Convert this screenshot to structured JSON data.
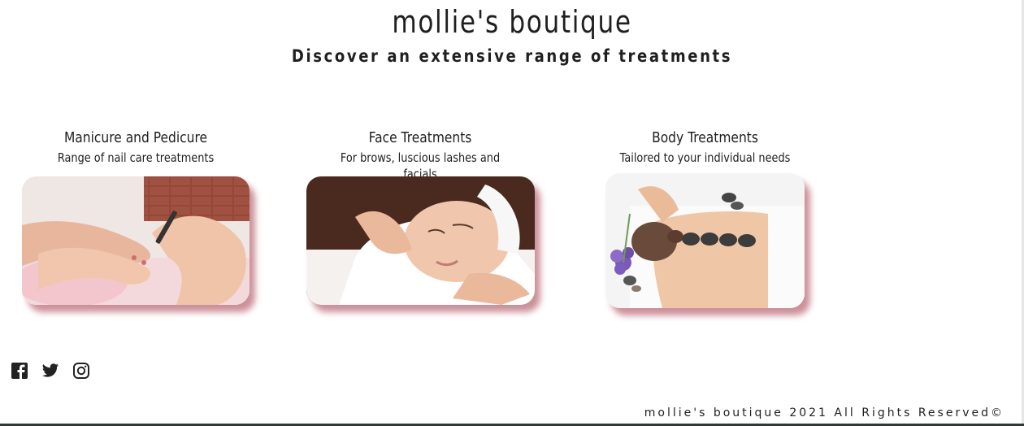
{
  "header": {
    "brand": "mollie's boutique",
    "tagline": "Discover an extensive range of treatments"
  },
  "cards": [
    {
      "title": "Manicure and Pedicure",
      "subtitle": "Range of nail care treatments",
      "image_icon": "manicure-photo"
    },
    {
      "title": "Face Treatments",
      "subtitle": "For brows, luscious lashes and facials",
      "image_icon": "facial-photo"
    },
    {
      "title": "Body Treatments",
      "subtitle": "Tailored to your individual needs",
      "image_icon": "hot-stone-massage-photo"
    }
  ],
  "socials": [
    {
      "icon": "facebook-icon"
    },
    {
      "icon": "twitter-icon"
    },
    {
      "icon": "instagram-icon"
    }
  ],
  "footer": {
    "copyright": "mollie's boutique 2021 All Rights Reserved",
    "symbol": "©"
  },
  "colors": {
    "text": "#1f1f1f",
    "shadow_accent": "#b05462"
  }
}
